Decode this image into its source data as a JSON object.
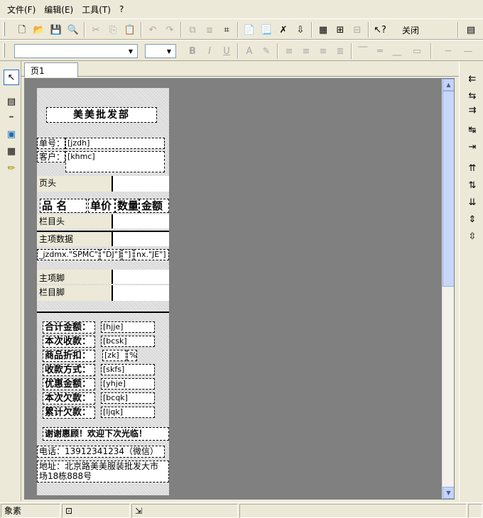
{
  "menu": {
    "items": [
      "文件(F)",
      "编辑(E)",
      "工具(T)",
      "?"
    ]
  },
  "toolbar1": {
    "close_label": "关闭"
  },
  "tabs": [
    "页1"
  ],
  "report": {
    "title": "美美批发部",
    "order_no_label": "单号：",
    "order_no_field": "[jzdh]",
    "customer_label": "客户：",
    "customer_field": "[khmc]",
    "band_page_header": "页头",
    "col_name": "品 名",
    "col_price": "单价",
    "col_qty": "数量",
    "col_amount": "金额",
    "band_column_header": "栏目头",
    "band_main_data": "主项数据",
    "field_spmc": "_jzdmx.\"SPMC\"]",
    "field_dj": "\"DJ\"]",
    "field_sl": "\"]",
    "field_je": "nx.\"JE\"]",
    "band_main_footer": "主项脚",
    "band_column_footer": "栏目脚",
    "summary": [
      {
        "label": "合计金额：",
        "field": "[hjje]"
      },
      {
        "label": "本次收款：",
        "field": "[bcsk]"
      },
      {
        "label": "商品折扣：",
        "field": "[zk]"
      },
      {
        "label": "收款方式：",
        "field": "[skfs]"
      },
      {
        "label": "优惠金额：",
        "field": "[yhje]"
      },
      {
        "label": "本次欠款：",
        "field": "[bcqk]"
      },
      {
        "label": "累计欠款：",
        "field": "[ljqk]"
      }
    ],
    "discount_unit": "%",
    "thanks": "谢谢惠顾！欢迎下次光临！",
    "phone": "电话：13912341234（微信）",
    "address_line1": "地址：北京路美美服装批发大市",
    "address_line2": "场18栋888号"
  },
  "status": {
    "pane1": "象素"
  }
}
